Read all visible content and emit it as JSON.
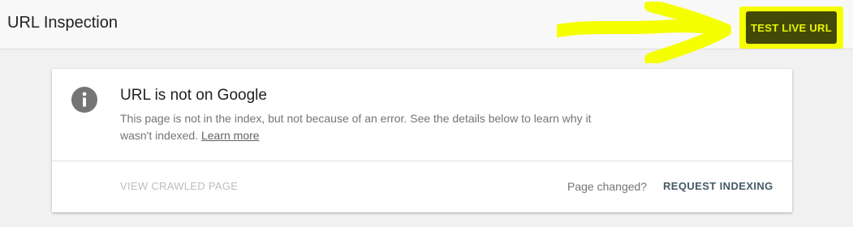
{
  "header": {
    "title": "URL Inspection",
    "test_live_url_label": "TEST LIVE URL"
  },
  "status_card": {
    "icon": "info-icon",
    "title": "URL is not on Google",
    "description": "This page is not in the index, but not because of an error. See the details below to learn why it wasn't indexed.",
    "learn_more_label": "Learn more",
    "view_crawled_page_label": "VIEW CRAWLED PAGE",
    "page_changed_label": "Page changed?",
    "request_indexing_label": "REQUEST INDEXING"
  },
  "annotation": {
    "arrow_color": "#f6ff00",
    "highlight_color": "#f6ff00",
    "arrow_icon": "arrow-right-icon"
  },
  "colors": {
    "button_bg": "#434a08",
    "button_text": "#e9f600",
    "info_icon": "#757575"
  }
}
